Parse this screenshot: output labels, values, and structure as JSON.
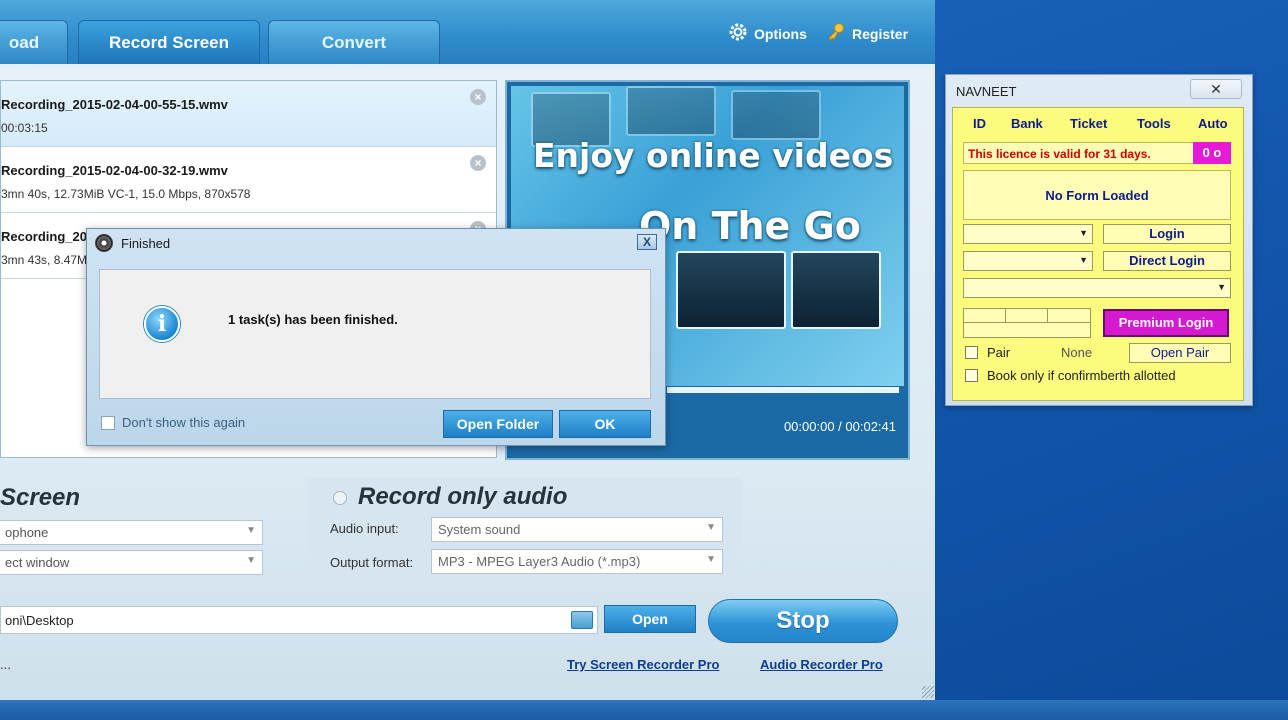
{
  "app": {
    "tabs": [
      {
        "label": "oad"
      },
      {
        "label": "Record Screen"
      },
      {
        "label": "Convert"
      }
    ],
    "options_label": "Options",
    "register_label": "Register",
    "files": [
      {
        "name": "Recording_2015-02-04-00-55-15.wmv",
        "info": "00:03:15"
      },
      {
        "name": "Recording_2015-02-04-00-32-19.wmv",
        "info": "3mn 40s, 12.73MiB    VC-1, 15.0 Mbps, 870x578"
      },
      {
        "name": "Recording_20",
        "info": "3mn 43s, 8.47M"
      }
    ],
    "preview": {
      "headline_1": "Enjoy online videos",
      "headline_2": "On The Go",
      "time": "00:00:00 / 00:02:41"
    },
    "screen_heading": "Screen",
    "screen_combo_1": "ophone",
    "screen_combo_2": "ect window",
    "audio": {
      "heading": "Record only audio",
      "input_label": "Audio input:",
      "input_value": "System sound",
      "format_label": "Output format:",
      "format_value": "MP3 - MPEG Layer3 Audio (*.mp3)"
    },
    "path": "oni\\Desktop",
    "open_label": "Open",
    "stop_label": "Stop",
    "status_dots": "...",
    "link_pro": "Try Screen Recorder Pro",
    "link_audio": "Audio Recorder Pro"
  },
  "dialog": {
    "title": "Finished",
    "message": "1 task(s) has been finished.",
    "dont_show": "Don't show this again",
    "open_folder": "Open Folder",
    "ok": "OK",
    "close": "X",
    "info_glyph": "i"
  },
  "navneet": {
    "title": "NAVNEET",
    "close": "✕",
    "menu": [
      "ID",
      "Bank",
      "Ticket",
      "Tools",
      "Auto"
    ],
    "licence": "This licence is valid for 31 days.",
    "badge": "0 o",
    "no_form": "No Form Loaded",
    "login": "Login",
    "direct_login": "Direct Login",
    "premium_login": "Premium Login",
    "pair_label": "Pair",
    "pair_value": "None",
    "open_pair": "Open Pair",
    "book_only": "Book only if confirmberth allotted"
  },
  "colors": {
    "accent_blue": "#2f8ccc",
    "yellow_panel": "#fbfb7e",
    "premium_magenta": "#d519d0",
    "licence_red": "#d10000"
  }
}
